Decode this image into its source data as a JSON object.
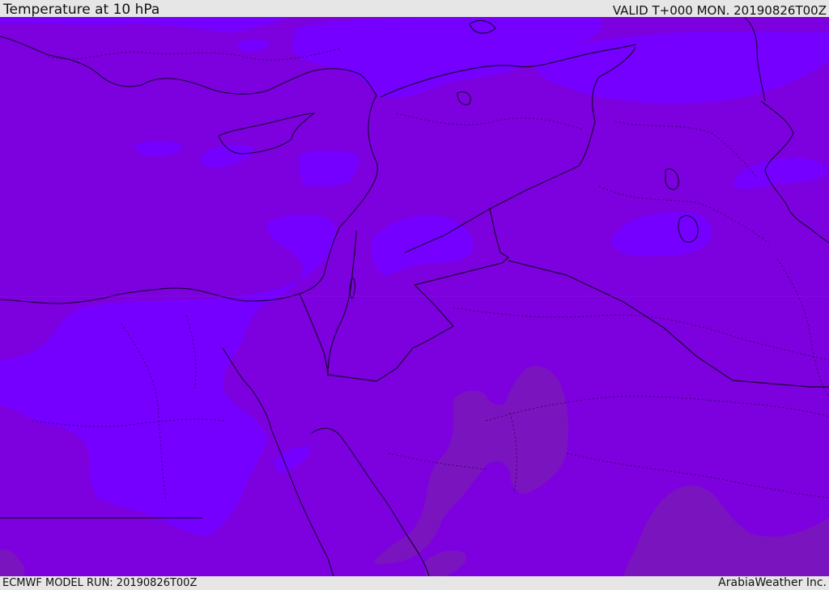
{
  "header": {
    "title": "Temperature at 10 hPa",
    "valid": "VALID T+000 MON. 20190826T00Z"
  },
  "footer": {
    "model_run": "ECMWF MODEL RUN: 20190826T00Z",
    "credit": "ArabiaWeather Inc."
  },
  "colors": {
    "base_fill": "#7d00de",
    "light_fill": "#7500ff",
    "dark_fill": "#7a14be",
    "border_line": "#1a0033"
  }
}
